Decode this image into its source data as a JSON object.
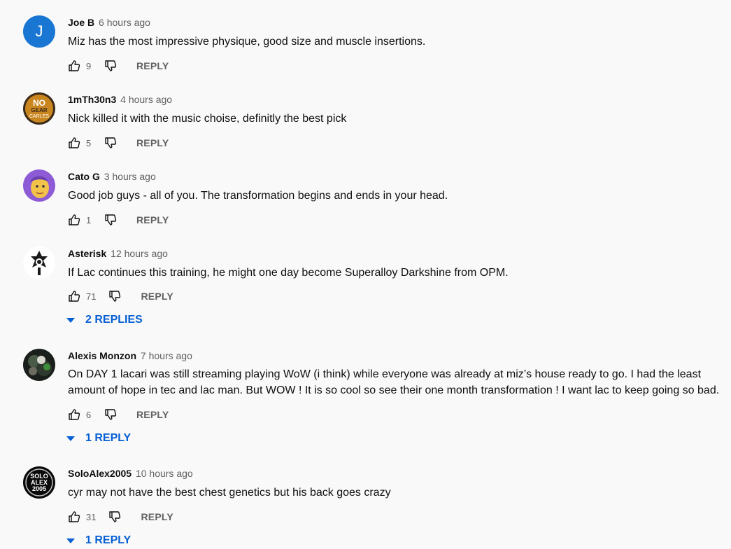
{
  "comments": [
    {
      "author": "Joe B",
      "time": "6 hours ago",
      "avatar_initial": "J",
      "avatar_icon": "letter-avatar",
      "text": "Miz has the most impressive physique, good size and muscle insertions.",
      "likes": "9",
      "reply_label": "REPLY"
    },
    {
      "author": "1mTh30n3",
      "time": "4 hours ago",
      "avatar_icon": "no-gear-avatar",
      "avatar_text": [
        "NO",
        "GEAR",
        "CARLES"
      ],
      "text": "Nick killed it with the music choise, definitly the best pick",
      "likes": "5",
      "reply_label": "REPLY"
    },
    {
      "author": "Cato G",
      "time": "3 hours ago",
      "avatar_icon": "cartoon-face-avatar",
      "text": "Good job guys - all of you. The transformation begins and ends in your head.",
      "likes": "1",
      "reply_label": "REPLY"
    },
    {
      "author": "Asterisk",
      "time": "12 hours ago",
      "avatar_icon": "emblem-avatar",
      "text": "If Lac continues this training, he might one day become Superalloy Darkshine from OPM.",
      "likes": "71",
      "reply_label": "REPLY",
      "replies_label": "2 REPLIES"
    },
    {
      "author": "Alexis Monzon",
      "time": "7 hours ago",
      "avatar_icon": "photo-avatar",
      "text": "On DAY 1 lacari was still streaming playing WoW (i think) while everyone was already at miz’s house ready to go. I had the least amount of hope in tec and lac man. But WOW ! It is so cool so see their one month transformation ! I want lac to keep going so bad.",
      "likes": "6",
      "reply_label": "REPLY",
      "replies_label": "1 REPLY"
    },
    {
      "author": "SoloAlex2005",
      "time": "10 hours ago",
      "avatar_icon": "solo-alex-avatar",
      "avatar_text": [
        "SOLO",
        "ALEX",
        "2005"
      ],
      "text": "cyr may not have the best chest genetics but his back goes crazy",
      "likes": "31",
      "reply_label": "REPLY",
      "replies_label": "1 REPLY"
    }
  ],
  "colors": {
    "background": "#f9f9f9",
    "author": "#0f0f0f",
    "meta": "#606060",
    "link_blue": "#065fd4",
    "avatar_blue": "#1976d2"
  }
}
